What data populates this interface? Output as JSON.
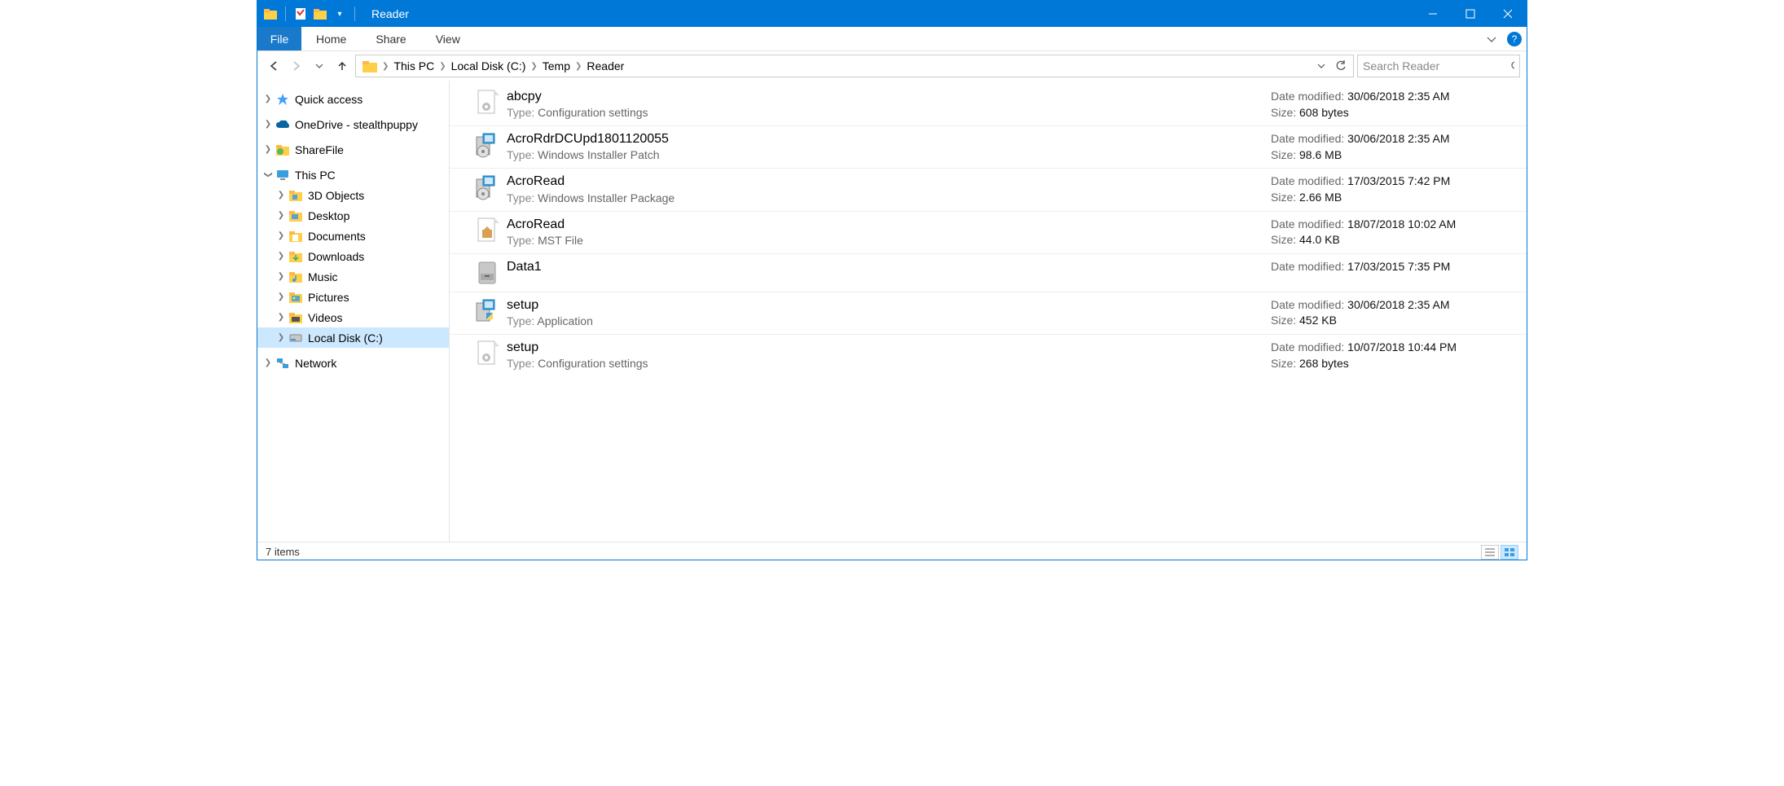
{
  "window": {
    "title": "Reader"
  },
  "ribbon": {
    "file": "File",
    "tabs": [
      "Home",
      "Share",
      "View"
    ]
  },
  "breadcrumb": [
    "This PC",
    "Local Disk (C:)",
    "Temp",
    "Reader"
  ],
  "search": {
    "placeholder": "Search Reader"
  },
  "nav": {
    "quick_access": "Quick access",
    "onedrive": "OneDrive - stealthpuppy",
    "sharefile": "ShareFile",
    "this_pc": "This PC",
    "this_pc_children": [
      "3D Objects",
      "Desktop",
      "Documents",
      "Downloads",
      "Music",
      "Pictures",
      "Videos",
      "Local Disk (C:)"
    ],
    "network": "Network"
  },
  "labels": {
    "type": "Type:",
    "date_modified": "Date modified:",
    "size": "Size:"
  },
  "files": [
    {
      "name": "abcpy",
      "type": "Configuration settings",
      "date": "30/06/2018 2:35 AM",
      "size": "608 bytes",
      "icon": "ini"
    },
    {
      "name": "AcroRdrDCUpd1801120055",
      "type": "Windows Installer Patch",
      "date": "30/06/2018 2:35 AM",
      "size": "98.6 MB",
      "icon": "msp"
    },
    {
      "name": "AcroRead",
      "type": "Windows Installer Package",
      "date": "17/03/2015 7:42 PM",
      "size": "2.66 MB",
      "icon": "msi"
    },
    {
      "name": "AcroRead",
      "type": "MST File",
      "date": "18/07/2018 10:02 AM",
      "size": "44.0 KB",
      "icon": "mst"
    },
    {
      "name": "Data1",
      "type": "",
      "date": "17/03/2015 7:35 PM",
      "size": "",
      "icon": "cab"
    },
    {
      "name": "setup",
      "type": "Application",
      "date": "30/06/2018 2:35 AM",
      "size": "452 KB",
      "icon": "exe"
    },
    {
      "name": "setup",
      "type": "Configuration settings",
      "date": "10/07/2018 10:44 PM",
      "size": "268 bytes",
      "icon": "ini"
    }
  ],
  "status": {
    "items": "7 items"
  }
}
